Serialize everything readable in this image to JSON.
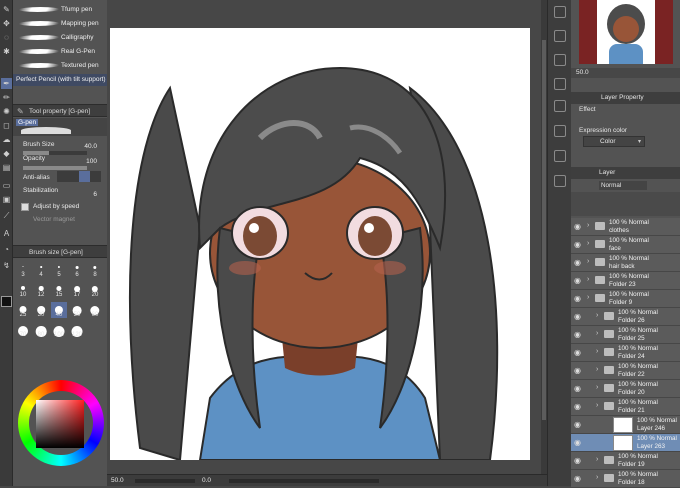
{
  "brushes": [
    {
      "name": "Tfump pen"
    },
    {
      "name": "Mapping pen"
    },
    {
      "name": "Calligraphy"
    },
    {
      "name": "Real G-Pen"
    },
    {
      "name": "Textured pen"
    },
    {
      "name": "Perfect Pencil (with tilt support)"
    }
  ],
  "tool_property": {
    "title": "Tool property [G-pen]",
    "tool_name": "G-pen",
    "brush_size_label": "Brush Size",
    "brush_size_value": "40.0",
    "opacity_label": "Opacity",
    "opacity_value": "100",
    "antialias_label": "Anti-alias",
    "stabilization_label": "Stabilization",
    "stabilization_value": "6",
    "adjust_speed_label": "Adjust by speed",
    "vector_magnet_label": "Vector magnet"
  },
  "brush_size_panel": {
    "title": "Brush size [G-pen]",
    "sizes": [
      "3",
      "4",
      "5",
      "6",
      "8",
      "10",
      "12",
      "15",
      "17",
      "20",
      "25",
      "30",
      "40",
      "50",
      "60",
      "70",
      "80",
      "100",
      "120"
    ],
    "selected": "40"
  },
  "navigator": {
    "zoom": "50.0"
  },
  "layer_property": {
    "title": "Layer Property",
    "effect_label": "Effect",
    "expression_color_label": "Expression color",
    "expression_color_value": "Color"
  },
  "layer_panel": {
    "title": "Layer",
    "blend_mode": "Normal",
    "layers": [
      {
        "l1": "100 % Normal",
        "l2": "clothes",
        "kind": "folder",
        "indent": 0
      },
      {
        "l1": "100 % Normal",
        "l2": "face",
        "kind": "folder",
        "indent": 0
      },
      {
        "l1": "100 % Normal",
        "l2": "hair back",
        "kind": "folder",
        "indent": 0
      },
      {
        "l1": "100 % Normal",
        "l2": "Folder 23",
        "kind": "folder",
        "indent": 0
      },
      {
        "l1": "100 % Normal",
        "l2": "Folder 9",
        "kind": "folder",
        "indent": 0
      },
      {
        "l1": "100 % Normal",
        "l2": "Folder 26",
        "kind": "folder",
        "indent": 1
      },
      {
        "l1": "100 % Normal",
        "l2": "Folder 25",
        "kind": "folder",
        "indent": 1
      },
      {
        "l1": "100 % Normal",
        "l2": "Folder 24",
        "kind": "folder",
        "indent": 1
      },
      {
        "l1": "100 % Normal",
        "l2": "Folder 22",
        "kind": "folder",
        "indent": 1
      },
      {
        "l1": "100 % Normal",
        "l2": "Folder 20",
        "kind": "folder",
        "indent": 1
      },
      {
        "l1": "100 % Normal",
        "l2": "Folder 21",
        "kind": "folder",
        "indent": 1
      },
      {
        "l1": "100 % Normal",
        "l2": "Layer 246",
        "kind": "layer",
        "indent": 2
      },
      {
        "l1": "100 % Normal",
        "l2": "Layer 263",
        "kind": "layer",
        "indent": 2,
        "selected": true
      },
      {
        "l1": "100 % Normal",
        "l2": "Folder 19",
        "kind": "folder",
        "indent": 1
      },
      {
        "l1": "100 % Normal",
        "l2": "Folder 18",
        "kind": "folder",
        "indent": 1
      }
    ]
  },
  "status": {
    "zoom": "50.0",
    "rotation": "0.0"
  },
  "colors": {
    "accent": "#5a6e9c",
    "selected_layer": "#6f8db5",
    "panel": "#535353"
  }
}
